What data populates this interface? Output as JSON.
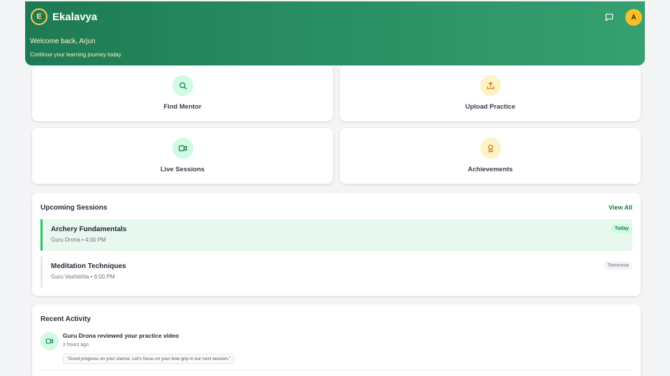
{
  "header": {
    "logo_letter": "E",
    "app_name": "Ekalavya",
    "welcome": "Welcome back, Arjun",
    "subtitle": "Continue your learning journey today",
    "avatar_initial": "A"
  },
  "actions": [
    {
      "label": "Find Mentor",
      "icon": "search-icon",
      "tone": "green"
    },
    {
      "label": "Upload Practice",
      "icon": "upload-icon",
      "tone": "yellow"
    },
    {
      "label": "Live Sessions",
      "icon": "video-icon",
      "tone": "green"
    },
    {
      "label": "Achievements",
      "icon": "award-icon",
      "tone": "yellow"
    }
  ],
  "upcoming": {
    "title": "Upcoming Sessions",
    "view_all": "View All",
    "sessions": [
      {
        "title": "Archery Fundamentals",
        "meta": "Guru Drona • 4:00 PM",
        "badge": "Today"
      },
      {
        "title": "Meditation Techniques",
        "meta": "Guru Vashishta • 6:00 PM",
        "badge": "Tomorrow"
      }
    ]
  },
  "activity": {
    "title": "Recent Activity",
    "items": [
      {
        "title": "Guru Drona reviewed your practice video",
        "time": "2 hours ago",
        "quote": "\"Good progress on your stance. Let's focus on your bow grip in our next session.\"",
        "icon": "video-icon"
      }
    ]
  },
  "colors": {
    "brand_green": "#1e7a54",
    "accent_yellow": "#fbbf24",
    "light_green": "#d1fae5",
    "light_yellow": "#fef3c7"
  }
}
